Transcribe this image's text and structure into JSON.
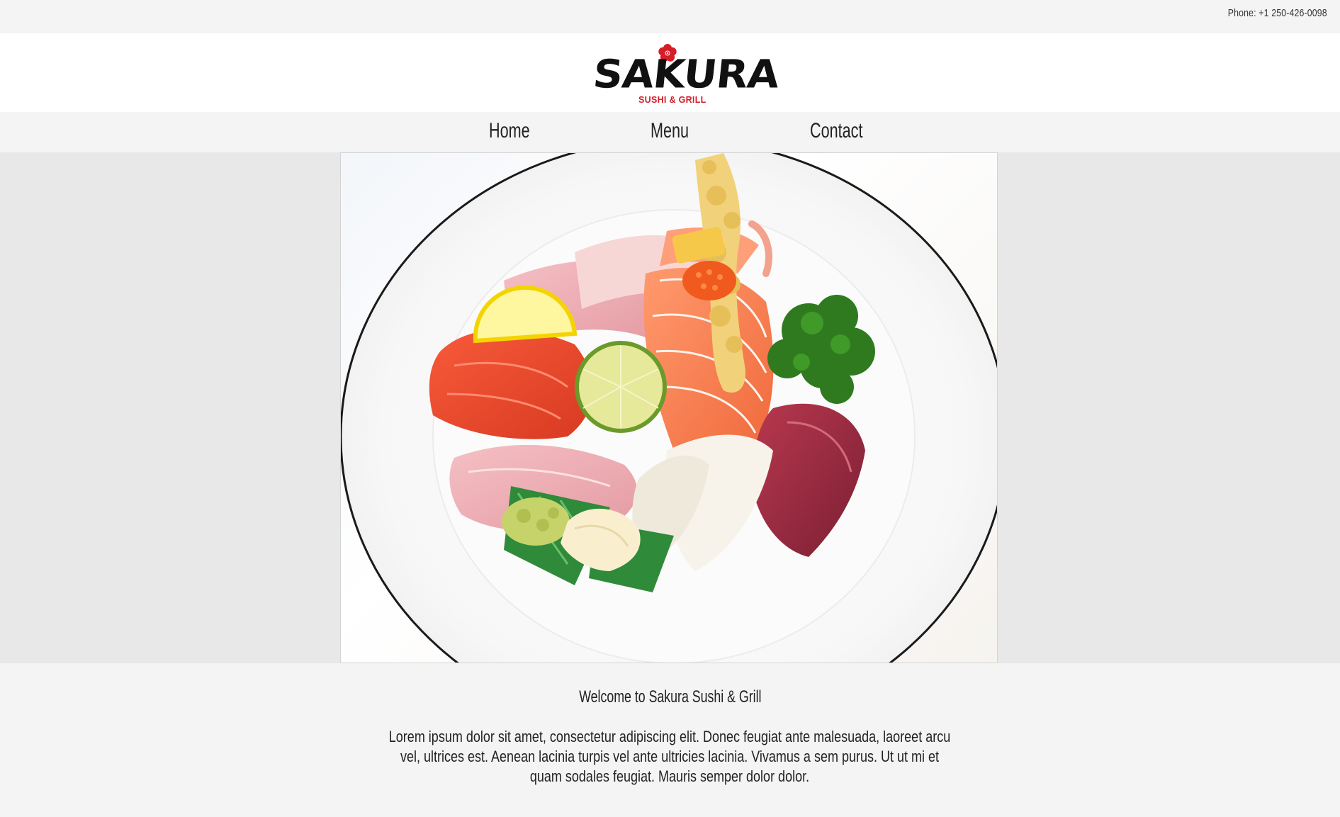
{
  "topbar": {
    "phone": "Phone: +1 250-426-0098"
  },
  "logo": {
    "name": "SAKURA",
    "tagline": "SUSHI & GRILL",
    "brand_red": "#d41e2a",
    "brand_black": "#111111"
  },
  "nav": {
    "items": [
      {
        "label": "Home"
      },
      {
        "label": "Menu"
      },
      {
        "label": "Contact"
      }
    ]
  },
  "hero": {
    "image_subject": "sashimi-plate"
  },
  "welcome": {
    "title": "Welcome to Sakura Sushi & Grill",
    "body": "Lorem ipsum dolor sit amet, consectetur adipiscing elit. Donec feugiat ante malesuada, laoreet arcu vel, ultrices est. Aenean lacinia turpis vel ante ultricies lacinia. Vivamus a sem purus. Ut ut mi et quam sodales feugiat. Mauris semper dolor dolor."
  },
  "colors": {
    "page_bg": "#f4f4f4",
    "band_bg": "#e8e8e8",
    "header_bg": "#ffffff",
    "text": "#222222"
  }
}
